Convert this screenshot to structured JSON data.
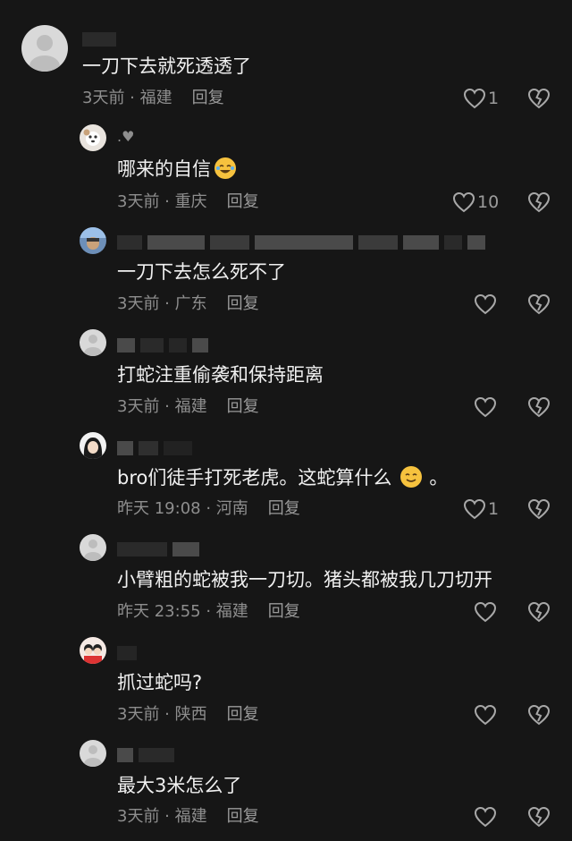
{
  "comments": [
    {
      "text": "一刀下去就死透透了",
      "time": "3天前",
      "location": "福建",
      "reply": "回复",
      "likes": "1"
    },
    {
      "text": "哪来的自信",
      "time": "3天前",
      "location": "重庆",
      "reply": "回复",
      "likes": "10",
      "name": ".♥"
    },
    {
      "text": "一刀下去怎么死不了",
      "time": "3天前",
      "location": "广东",
      "reply": "回复",
      "likes": ""
    },
    {
      "text": "打蛇注重偷袭和保持距离",
      "time": "3天前",
      "location": "福建",
      "reply": "回复",
      "likes": ""
    },
    {
      "text": "bro们徒手打死老虎。这蛇算什么",
      "text_suffix": "。",
      "time": "昨天 19:08",
      "location": "河南",
      "reply": "回复",
      "likes": "1"
    },
    {
      "text": "小臂粗的蛇被我一刀切。猪头都被我几刀切开",
      "time": "昨天 23:55",
      "location": "福建",
      "reply": "回复",
      "likes": ""
    },
    {
      "text": "抓过蛇吗?",
      "time": "3天前",
      "location": "陕西",
      "reply": "回复",
      "likes": ""
    },
    {
      "text": "最大3米怎么了",
      "time": "3天前",
      "location": "福建",
      "reply": "回复",
      "likes": ""
    }
  ],
  "meta_separator": " · ",
  "colors": {
    "background": "#161616",
    "text": "#f0f0f0",
    "meta": "#8e8e8e"
  }
}
